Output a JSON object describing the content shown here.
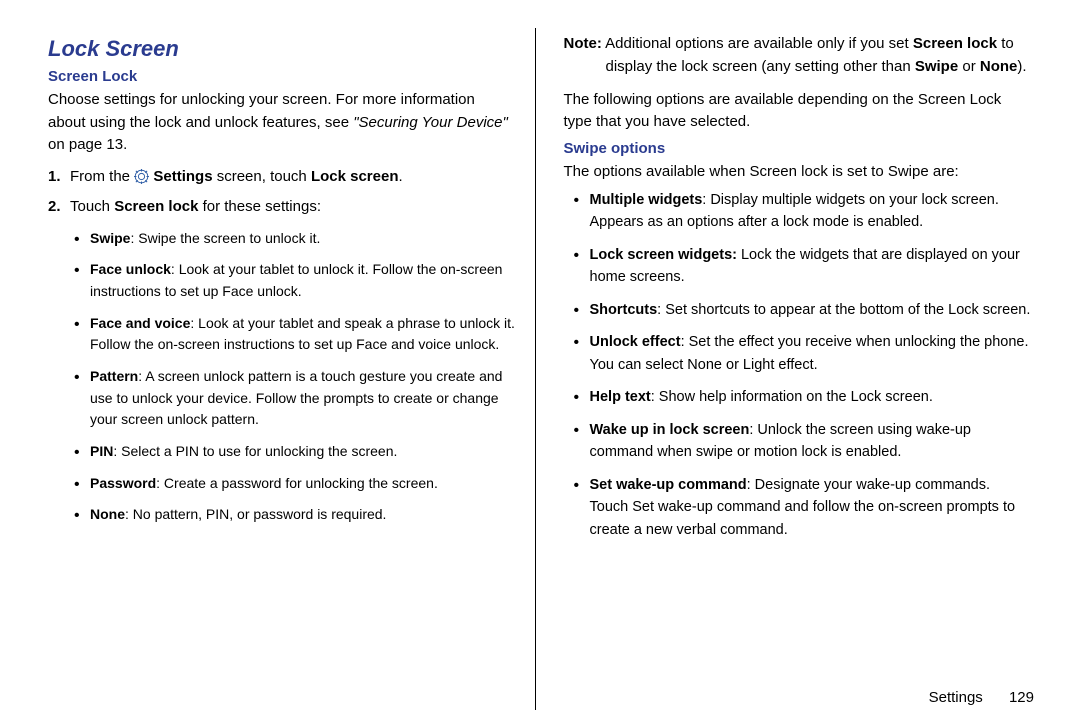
{
  "left": {
    "title": "Lock Screen",
    "subtitle": "Screen Lock",
    "intro_pre": "Choose settings for unlocking your screen. For more information about using the lock and unlock features, see ",
    "intro_ref": "\"Securing Your Device\"",
    "intro_post": " on page 13.",
    "step1_pre": "From the ",
    "step1_b1": "Settings",
    "step1_mid": " screen, touch ",
    "step1_b2": "Lock screen",
    "step1_end": ".",
    "step2_pre": "Touch ",
    "step2_b": "Screen lock",
    "step2_post": " for these settings:",
    "opts": {
      "swipe": {
        "label": "Swipe",
        "text": ": Swipe the screen to unlock it."
      },
      "face": {
        "label": "Face unlock",
        "text": ": Look at your tablet to unlock it. Follow the on-screen instructions to set up Face unlock."
      },
      "facevoice": {
        "label": "Face and voice",
        "text": ": Look at your tablet and speak a phrase to unlock it. Follow the on-screen instructions to set up Face and voice unlock."
      },
      "pattern": {
        "label": "Pattern",
        "text": ": A screen unlock pattern is a touch gesture you create and use to unlock your device. Follow the prompts to create or change your screen unlock pattern."
      },
      "pin": {
        "label": "PIN",
        "text": ": Select a PIN to use for unlocking the screen."
      },
      "password": {
        "label": "Password",
        "text": ": Create a password for unlocking the screen."
      },
      "none": {
        "label": "None",
        "text": ": No pattern, PIN, or password is required."
      }
    }
  },
  "right": {
    "note_label": "Note:",
    "note_pre": " Additional options are available only if you set ",
    "note_b1": "Screen lock",
    "note_mid": " to display the lock screen (any setting other than ",
    "note_b2": "Swipe",
    "note_or": " or ",
    "note_b3": "None",
    "note_end": ").",
    "para2": "The following options are available depending on the Screen Lock type that you have selected.",
    "swipe_heading": "Swipe options",
    "swipe_intro": "The options available when Screen lock is set to Swipe are:",
    "opts": {
      "mw": {
        "label": "Multiple widgets",
        "text": ": Display multiple widgets on your lock screen. Appears as an options after a lock mode is enabled."
      },
      "lsw": {
        "label": "Lock screen widgets:",
        "text": " Lock the widgets that are displayed on your home screens."
      },
      "sc": {
        "label": "Shortcuts",
        "text": ": Set shortcuts to appear at the bottom of the Lock screen."
      },
      "ue": {
        "label": "Unlock effect",
        "text": ": Set the effect you receive when unlocking the phone. You can select None or Light effect."
      },
      "ht": {
        "label": "Help text",
        "text": ": Show help information on the Lock screen."
      },
      "wu": {
        "label": "Wake up in lock screen",
        "text": ": Unlock the screen using wake-up command when swipe or motion lock is enabled."
      },
      "swc": {
        "label": "Set wake-up command",
        "text": ": Designate your wake-up commands. Touch Set wake-up command and follow the on-screen prompts to create a new verbal command."
      }
    }
  },
  "footer": {
    "section": "Settings",
    "page": "129"
  }
}
